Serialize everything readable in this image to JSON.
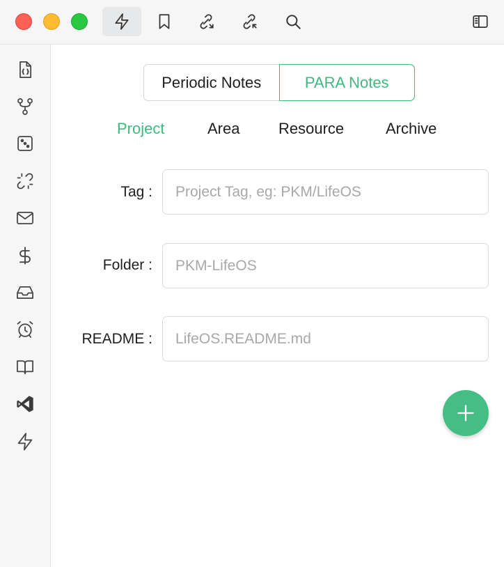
{
  "toolbar": {
    "icons": [
      "lightning-icon",
      "bookmark-icon",
      "outgoing-link-icon",
      "backlink-icon",
      "search-icon",
      "sidebar-toggle-icon"
    ],
    "active_icon": "lightning-icon"
  },
  "sidebar": {
    "icons": [
      "file-code-icon",
      "git-branch-icon",
      "dice-icon",
      "broken-link-icon",
      "mail-icon",
      "dollar-icon",
      "inbox-icon",
      "alarm-clock-icon",
      "book-icon",
      "vscode-icon",
      "lightning-icon"
    ]
  },
  "segment": {
    "options": [
      "Periodic Notes",
      "PARA Notes"
    ],
    "selected": "PARA Notes"
  },
  "tabs": {
    "items": [
      "Project",
      "Area",
      "Resource",
      "Archive"
    ],
    "selected": "Project"
  },
  "form": {
    "tag": {
      "label": "Tag",
      "colon": ":",
      "placeholder": "Project Tag, eg: PKM/LifeOS",
      "value": ""
    },
    "folder": {
      "label": "Folder",
      "colon": ":",
      "placeholder": "PKM-LifeOS",
      "value": ""
    },
    "readme": {
      "label": "README",
      "colon": ":",
      "placeholder": "LifeOS.README.md",
      "value": ""
    }
  },
  "add_button": {
    "icon": "plus-icon"
  },
  "colors": {
    "accent": "#3fb97f",
    "fab": "#45be85",
    "close": "#fe5f57",
    "minimize": "#febc2e",
    "zoom": "#28c840"
  }
}
